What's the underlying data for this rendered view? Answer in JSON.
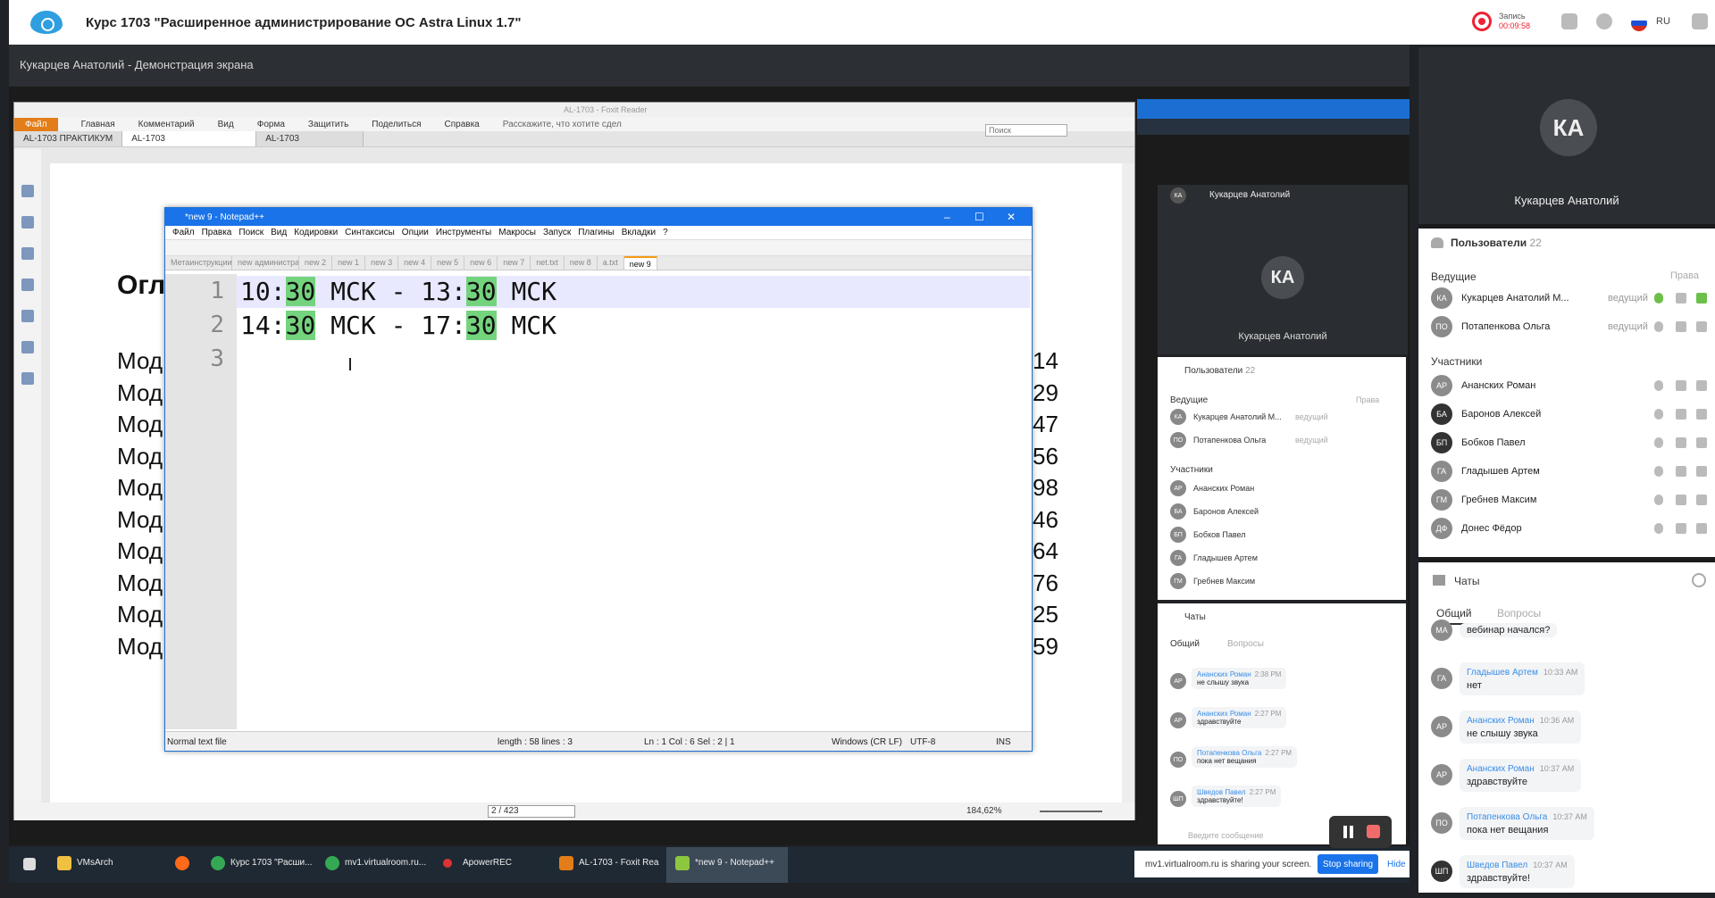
{
  "app": {
    "course_title": "Курс 1703 \"Расширенное администрирование ОС Astra Linux 1.7\"",
    "record_label": "Запись",
    "record_time": "00:09:58",
    "lang": "RU",
    "presenter_screen": "Кукарцев Анатолий - Демонстрация экрана"
  },
  "foxit": {
    "title": "AL-1703 - Foxit Reader",
    "menu": [
      "Файл",
      "Главная",
      "Комментарий",
      "Вид",
      "Форма",
      "Защитить",
      "Поделиться",
      "Справка",
      "Расскажите, что хотите сдел"
    ],
    "search_placeholder": "Поиск",
    "tabs": [
      "AL-1703 ПРАКТИКУМ",
      "AL-1703",
      "AL-1703"
    ],
    "page_heading": "Огл",
    "mod_label": "Мод",
    "page_numbers": [
      "14",
      "29",
      "47",
      "56",
      "98",
      "46",
      "64",
      "76",
      "25",
      "59"
    ],
    "page_indicator": "2 / 423",
    "zoom": "184,62%"
  },
  "notepad": {
    "title": "*new 9 - Notepad++",
    "menu": [
      "Файл",
      "Правка",
      "Поиск",
      "Вид",
      "Кодировки",
      "Синтаксисы",
      "Опции",
      "Инструменты",
      "Макросы",
      "Запуск",
      "Плагины",
      "Вкладки",
      "?"
    ],
    "tabs": [
      "МетаинструкцииALDPar.txt",
      "new администрации.txt",
      "new 2",
      "new 1",
      "new 3",
      "new 4",
      "new 5",
      "new 6",
      "new 7",
      "net.txt",
      "new 8",
      "a.txt",
      "new 9"
    ],
    "lines": [
      {
        "num": "1",
        "a": "10:",
        "h1": "30",
        "b": " МСК - 13:",
        "h2": "30",
        "c": " МСК"
      },
      {
        "num": "2",
        "a": "14:",
        "h1": "30",
        "b": " МСК - 17:",
        "h2": "30",
        "c": " МСК"
      },
      {
        "num": "3",
        "a": "",
        "h1": "",
        "b": "",
        "h2": "",
        "c": ""
      }
    ],
    "status": {
      "type": "Normal text file",
      "length": "length : 58    lines : 3",
      "pos": "Ln : 1    Col : 6    Sel : 2 | 1",
      "eol": "Windows (CR LF)",
      "enc": "UTF-8",
      "ins": "INS"
    }
  },
  "mid": {
    "presenter": "Кукарцев Анатолий",
    "presenter_initials": "КА",
    "lang": "RU",
    "users_title": "Пользователи",
    "users_count": "22",
    "hosts_label": "Ведущие",
    "rights_label": "Права",
    "participants_label": "Участники",
    "hosts": [
      {
        "i": "КА",
        "name": "Кукарцев Анатолий М...",
        "role": "ведущий"
      },
      {
        "i": "ПО",
        "name": "Потапенкова Ольга",
        "role": "ведущий"
      }
    ],
    "participants": [
      {
        "i": "АР",
        "name": "Ананских Роман"
      },
      {
        "i": "БА",
        "name": "Баронов Алексей"
      },
      {
        "i": "БП",
        "name": "Бобков Павел"
      },
      {
        "i": "ГА",
        "name": "Гладышев Артем"
      },
      {
        "i": "ГМ",
        "name": "Гребнев Максим"
      }
    ],
    "chats_title": "Чаты",
    "chat_tabs": [
      "Общий",
      "Вопросы"
    ],
    "messages": [
      {
        "i": "АР",
        "name": "Ананских Роман",
        "time": "2:38 PM",
        "text": "не слышу звука"
      },
      {
        "i": "АР",
        "name": "Ананских Роман",
        "time": "2:27 PM",
        "text": "здравствуйте"
      },
      {
        "i": "ПО",
        "name": "Потапенкова Ольга",
        "time": "2:27 PM",
        "text": "пока нет вещания"
      },
      {
        "i": "ШП",
        "name": "Шведов Павел",
        "time": "2:27 PM",
        "text": "здравствуйте!"
      }
    ],
    "input_placeholder": "Введите сообщение"
  },
  "right": {
    "presenter": "Кукарцев Анатолий",
    "presenter_initials": "КА",
    "users_title": "Пользователи",
    "users_count": "22",
    "hosts_label": "Ведущие",
    "rights_label": "Права",
    "participants_label": "Участники",
    "hosts": [
      {
        "i": "КА",
        "name": "Кукарцев Анатолий М...",
        "role": "ведущий"
      },
      {
        "i": "ПО",
        "name": "Потапенкова Ольга",
        "role": "ведущий"
      }
    ],
    "participants": [
      {
        "i": "АР",
        "name": "Ананских Роман"
      },
      {
        "i": "БА",
        "name": "Баронов Алексей"
      },
      {
        "i": "БП",
        "name": "Бобков Павел"
      },
      {
        "i": "ГА",
        "name": "Гладышев Артем"
      },
      {
        "i": "ГМ",
        "name": "Гребнев Максим"
      },
      {
        "i": "ДФ",
        "name": "Донес Фёдор"
      }
    ],
    "chats_title": "Чаты",
    "chat_tabs": [
      "Общий",
      "Вопросы"
    ],
    "first_msg": "вебинар начался?",
    "first_msg_initials": "МА",
    "messages": [
      {
        "i": "ГА",
        "name": "Гладышев Артем",
        "time": "10:33 AM",
        "text": "нет"
      },
      {
        "i": "АР",
        "name": "Ананских Роман",
        "time": "10:36 AM",
        "text": "не слышу звука"
      },
      {
        "i": "АР",
        "name": "Ананских Роман",
        "time": "10:37 AM",
        "text": "здравствуйте"
      },
      {
        "i": "ПО",
        "name": "Потапенкова Ольга",
        "time": "10:37 AM",
        "text": "пока нет вещания"
      },
      {
        "i": "ШП",
        "name": "Шведов Павел",
        "time": "10:37 AM",
        "text": "здравствуйте!"
      }
    ]
  },
  "taskbar": {
    "items": [
      "VMsArch",
      "Курс 1703 \"Расши...",
      "mv1.virtualroom.ru...",
      "ApowerREC",
      "AL-1703 - Foxit Rea",
      "*new 9 - Notepad++"
    ]
  },
  "sharebar": {
    "text": "mv1.virtualroom.ru is sharing your screen.",
    "stop": "Stop sharing",
    "hide": "Hide"
  }
}
